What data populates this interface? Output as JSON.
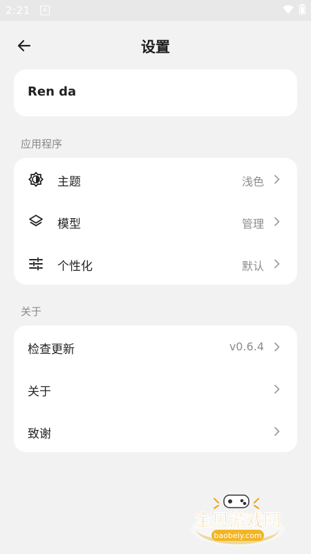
{
  "status_bar": {
    "time": "2:21",
    "notification_icon": "A"
  },
  "header": {
    "title": "设置",
    "back_icon": "arrow-left-icon"
  },
  "profile": {
    "name": "Ren da"
  },
  "sections": {
    "app": {
      "label": "应用程序",
      "items": [
        {
          "label": "主题",
          "value": "浅色",
          "icon": "brightness-icon"
        },
        {
          "label": "模型",
          "value": "管理",
          "icon": "layers-icon"
        },
        {
          "label": "个性化",
          "value": "默认",
          "icon": "sliders-icon"
        }
      ]
    },
    "about": {
      "label": "关于",
      "items": [
        {
          "label": "检查更新",
          "value": "v0.6.4"
        },
        {
          "label": "关于",
          "value": ""
        },
        {
          "label": "致谢",
          "value": ""
        }
      ]
    }
  },
  "watermark": {
    "title": "宝贝游戏网",
    "url": "baobeiy.com"
  },
  "colors": {
    "background": "#f2f2f2",
    "card": "#ffffff",
    "secondary_text": "#8a8a8a",
    "watermark": "#e6a41a"
  }
}
